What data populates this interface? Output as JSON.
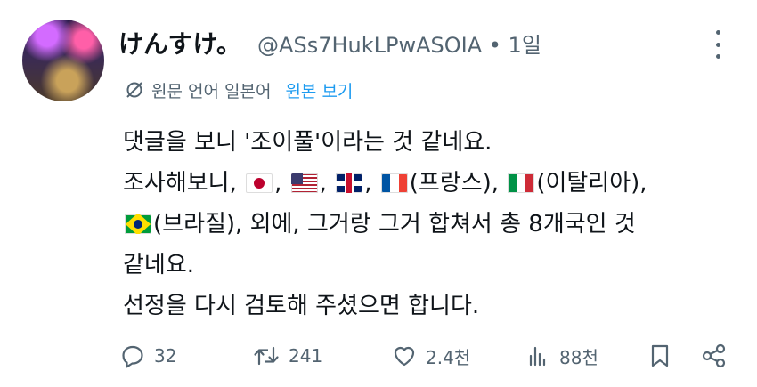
{
  "tweet": {
    "display_name": "けんすけ。",
    "handle_line": "@ASs7HukLPwASOIA • 1일",
    "translation": {
      "note": "원문 언어 일본어",
      "show_original": "원본 보기"
    },
    "body": {
      "line1": "댓글을 보니 '조이풀'이라는 것 같네요.",
      "line2_a": "조사해보니, ",
      "line2_b": ", ",
      "line2_c": ", ",
      "line2_d": ", ",
      "line2_e": "(프랑스), ",
      "line2_f": "(이탈리아),",
      "line3_a": "(브라질), 외에, 그거랑 그거 합쳐서 총 8개국인 것",
      "line4": "같네요.",
      "line5": "선정을 다시 검토해 주셨으면 합니다."
    },
    "flags": [
      "japan-flag",
      "usa-flag",
      "uk-flag",
      "france-flag",
      "italy-flag",
      "brazil-flag"
    ]
  },
  "actions": {
    "replies": "32",
    "reposts": "241",
    "likes": "2.4천",
    "views": "88천"
  },
  "colors": {
    "text": "#0f1419",
    "muted": "#536471",
    "link": "#1d9bf0"
  }
}
